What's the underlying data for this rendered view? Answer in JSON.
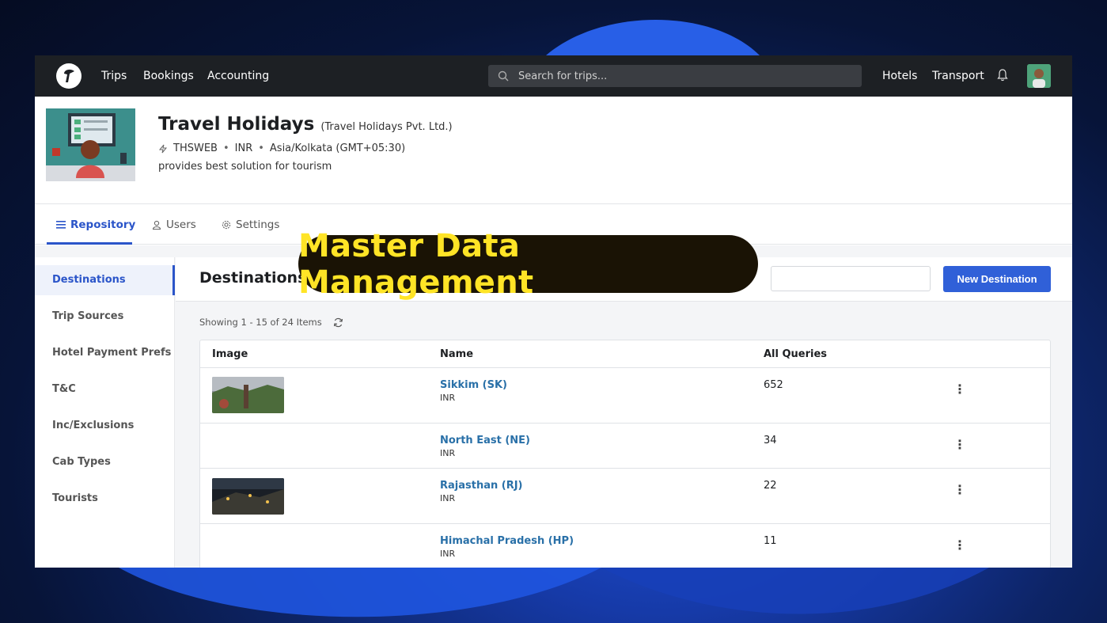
{
  "nav": {
    "links": [
      "Trips",
      "Bookings",
      "Accounting"
    ],
    "search_placeholder": "Search for trips...",
    "right_links": [
      "Hotels",
      "Transport"
    ]
  },
  "org": {
    "name": "Travel Holidays",
    "legal_name": "(Travel Holidays Pvt. Ltd.)",
    "code": "THSWEB",
    "currency": "INR",
    "timezone": "Asia/Kolkata (GMT+05:30)",
    "description": "provides best solution for tourism"
  },
  "tabs": [
    "Repository",
    "Users",
    "Settings"
  ],
  "sidebar": {
    "items": [
      "Destinations",
      "Trip Sources",
      "Hotel Payment Prefs",
      "T&C",
      "Inc/Exclusions",
      "Cab Types",
      "Tourists"
    ]
  },
  "main": {
    "title": "Destinations",
    "new_button": "New Destination",
    "showing": "Showing 1 - 15 of 24 Items"
  },
  "table": {
    "headers": [
      "Image",
      "Name",
      "All Queries"
    ],
    "rows": [
      {
        "name": "Sikkim (SK)",
        "currency": "INR",
        "queries": "652",
        "has_image": true
      },
      {
        "name": "North East (NE)",
        "currency": "INR",
        "queries": "34",
        "has_image": false
      },
      {
        "name": "Rajasthan (RJ)",
        "currency": "INR",
        "queries": "22",
        "has_image": true
      },
      {
        "name": "Himachal Pradesh (HP)",
        "currency": "INR",
        "queries": "11",
        "has_image": false
      }
    ]
  },
  "overlay": {
    "text": "Master Data Management"
  },
  "colors": {
    "accent": "#3060d8",
    "link": "#2970a8",
    "navbar": "#1d2024",
    "banner_text": "#ffe426"
  }
}
